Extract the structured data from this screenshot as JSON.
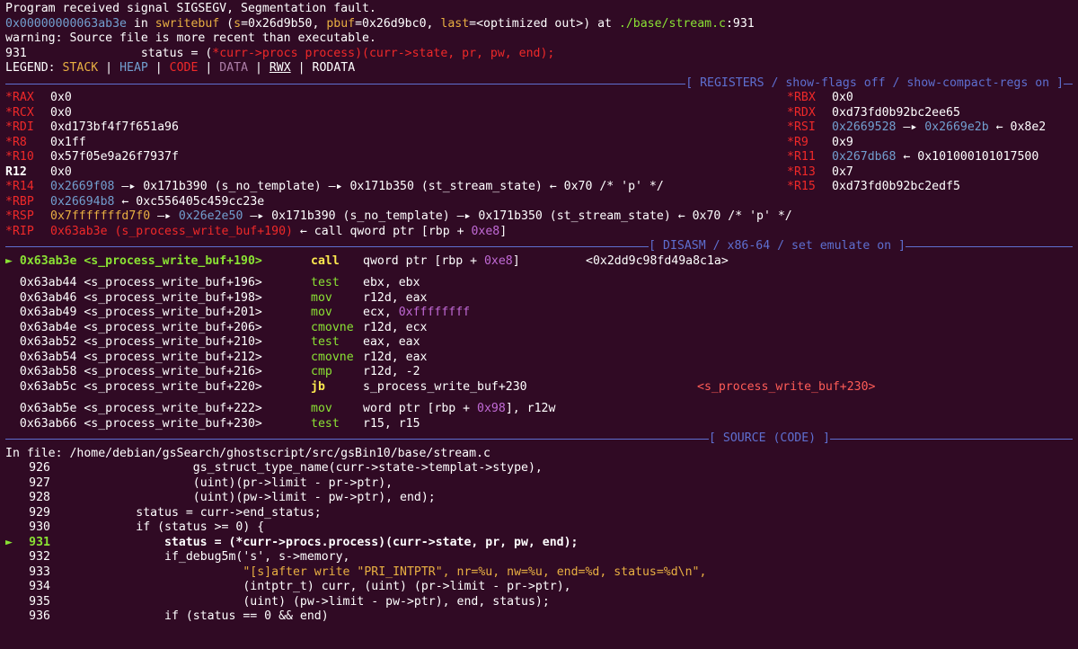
{
  "header": {
    "signal": "Program received signal SIGSEGV, Segmentation fault.",
    "frame_addr": "0x00000000063ab3e",
    "frame_in": " in ",
    "frame_func": "swritebuf",
    "frame_args_open": " (",
    "arg1_name": "s",
    "arg1_val": "=0x26d9b50, ",
    "arg2_name": "pbuf",
    "arg2_val": "=0x26d9bc0, ",
    "arg3_name": "last",
    "arg3_val": "=<optimized out>) at ",
    "file_path": "./base/stream.c",
    "line_suffix": ":931",
    "warning": "warning: Source file is more recent than executable.",
    "src_line_num": "931",
    "src_line_code_a": "                status = (",
    "src_line_code_b": "*curr->procs process",
    "src_line_code_c": ")(curr->state, pr, pw, end);"
  },
  "legend": {
    "label": "LEGEND: ",
    "stack": "STACK",
    "heap": "HEAP",
    "code": "CODE",
    "data": "DATA",
    "rwx": "RWX",
    "rodata": "RODATA",
    "sep": " | "
  },
  "separators": {
    "registers": "[ REGISTERS / show-flags off / show-compact-regs on ]",
    "disasm": "[ DISASM / x86-64 / set emulate on ]",
    "source": "[ SOURCE (CODE) ]"
  },
  "registers": {
    "rax": {
      "name": "*RAX",
      "val": "0x0"
    },
    "rbx": {
      "name": "*RBX",
      "val": "0x0"
    },
    "rcx": {
      "name": "*RCX",
      "val": "0x0"
    },
    "rdx": {
      "name": "*RDX",
      "val": "0xd73fd0b92bc2ee65"
    },
    "rdi": {
      "name": "*RDI",
      "val": "0xd173bf4f7f651a96"
    },
    "rsi": {
      "name": "*RSI",
      "val": "0x2669528",
      "arrow": " —▸ ",
      "ptr": "0x2669e2b",
      "arrow2": " ← ",
      "deref": "0x8e2"
    },
    "r8": {
      "name": "*R8",
      "val": "0x1ff"
    },
    "r9": {
      "name": "*R9",
      "val": "0x9"
    },
    "r10": {
      "name": "*R10",
      "val": "0x57f05e9a26f7937f"
    },
    "r11": {
      "name": "*R11",
      "val": "0x267db68",
      "arrow": " ← ",
      "deref": "0x101000101017500"
    },
    "r12": {
      "name": "R12",
      "val": "0x0"
    },
    "r13": {
      "name": "*R13",
      "val": "0x7"
    },
    "r14": {
      "name": "*R14",
      "val": "0x2669f08",
      "chain": " —▸ 0x171b390 (s_no_template) —▸ 0x171b350 (st_stream_state) ← 0x70 /* 'p' */"
    },
    "r15": {
      "name": "*R15",
      "val": "0xd73fd0b92bc2edf5"
    },
    "rbp": {
      "name": "*RBP",
      "val": "0x26694b8",
      "chain": " ← 0xc556405c459cc23e"
    },
    "rsp": {
      "name": "*RSP",
      "val": "0x7fffffffd7f0",
      "arrow": " —▸ ",
      "ptr": "0x26e2e50",
      "chain": " —▸ 0x171b390 (s_no_template) —▸ 0x171b350 (st_stream_state) ← 0x70 /* 'p' */"
    },
    "rip": {
      "name": "*RIP",
      "val": "0x63ab3e (s_process_write_buf+190)",
      "arrow": " ← ",
      "instr": "call",
      "instr_args_a": " qword ptr [rbp + ",
      "instr_args_b": "0xe8",
      "instr_args_c": "]"
    }
  },
  "disasm": [
    {
      "cur": true,
      "marker": "► ",
      "addr": "0x63ab3e <s_process_write_buf+190>",
      "op": "call",
      "args_a": "qword ptr [rbp + ",
      "args_b": "0xe8",
      "args_c": "]",
      "cmt": "<0x2dd9c98fd49a8c1a>"
    },
    {
      "gap": true
    },
    {
      "addr": "0x63ab44 <s_process_write_buf+196>",
      "op": "test",
      "args_a": "ebx, ebx",
      "args_b": "",
      "args_c": "",
      "cmt": ""
    },
    {
      "addr": "0x63ab46 <s_process_write_buf+198>",
      "op": "mov",
      "args_a": "r12d, eax",
      "args_b": "",
      "args_c": "",
      "cmt": ""
    },
    {
      "addr": "0x63ab49 <s_process_write_buf+201>",
      "op": "mov",
      "args_a": "ecx, ",
      "args_b": "0xffffffff",
      "args_c": "",
      "cmt": ""
    },
    {
      "addr": "0x63ab4e <s_process_write_buf+206>",
      "op": "cmovne",
      "args_a": "r12d, ecx",
      "args_b": "",
      "args_c": "",
      "cmt": ""
    },
    {
      "addr": "0x63ab52 <s_process_write_buf+210>",
      "op": "test",
      "args_a": "eax, eax",
      "args_b": "",
      "args_c": "",
      "cmt": ""
    },
    {
      "addr": "0x63ab54 <s_process_write_buf+212>",
      "op": "cmovne",
      "args_a": "r12d, eax",
      "args_b": "",
      "args_c": "",
      "cmt": ""
    },
    {
      "addr": "0x63ab58 <s_process_write_buf+216>",
      "op": "cmp",
      "args_a": "r12d, -2",
      "args_b": "",
      "args_c": "",
      "cmt": ""
    },
    {
      "addr": "0x63ab5c <s_process_write_buf+220>",
      "op": "jb",
      "args_a": "s_process_write_buf+230",
      "args_b": "",
      "args_c": "",
      "cmt": "<s_process_write_buf+230>",
      "jump": true
    },
    {
      "gap": true
    },
    {
      "addr": "0x63ab5e <s_process_write_buf+222>",
      "op": "mov",
      "args_a": "word ptr [rbp + ",
      "args_b": "0x98",
      "args_c": "], r12w",
      "cmt": ""
    },
    {
      "addr": "0x63ab66 <s_process_write_buf+230>",
      "op": "test",
      "args_a": "r15, r15",
      "args_b": "",
      "args_c": "",
      "cmt": ""
    }
  ],
  "source": {
    "in_file": "In file: /home/debian/gsSearch/ghostscript/src/gsBin10/base/stream.c",
    "lines": [
      {
        "n": "926",
        "code": "                    gs_struct_type_name(curr->state->templat->stype),"
      },
      {
        "n": "927",
        "code": "                    (uint)(pr->limit - pr->ptr),"
      },
      {
        "n": "928",
        "code": "                    (uint)(pw->limit - pw->ptr), end);"
      },
      {
        "n": "929",
        "code": "            status = curr->end_status;"
      },
      {
        "n": "930",
        "code": "            if (status >= 0) {"
      },
      {
        "n": "931",
        "code": "                status = (*curr->procs.process)(curr->state, pr, pw, end);",
        "cur": true
      },
      {
        "n": "932",
        "code": "                if_debug5m('s', s->memory,"
      },
      {
        "n": "933",
        "code": "                           \"[s]after write \"PRI_INTPTR\", nr=%u, nw=%u, end=%d, status=%d\\n\","
      },
      {
        "n": "934",
        "code": "                           (intptr_t) curr, (uint) (pr->limit - pr->ptr),"
      },
      {
        "n": "935",
        "code": "                           (uint) (pw->limit - pw->ptr), end, status);"
      },
      {
        "n": "936",
        "code": "                if (status == 0 && end)"
      }
    ]
  },
  "colors": {
    "background": "#300a24",
    "register_changed": "#ef2929",
    "heap": "#729fcf",
    "stack": "#e9b042",
    "code": "#ff5c57",
    "current_marker": "#8ae234",
    "separator": "#5e6fd0"
  }
}
